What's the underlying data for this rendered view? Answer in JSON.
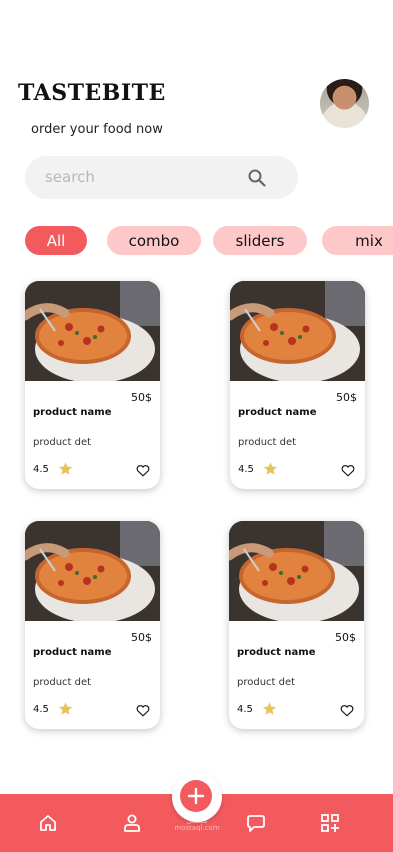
{
  "header": {
    "brand": "TASTEBITE",
    "tagline": "order your food  now",
    "avatar_icon": "user-avatar"
  },
  "search": {
    "placeholder": "search",
    "icon": "search-icon"
  },
  "categories": [
    {
      "label": "All",
      "active": true
    },
    {
      "label": "combo",
      "active": false
    },
    {
      "label": "sliders",
      "active": false
    },
    {
      "label": "mix",
      "active": false
    }
  ],
  "products": [
    {
      "name": "product name",
      "details": "product det",
      "price": "50$",
      "rating": "4.5"
    },
    {
      "name": "product name",
      "details": "product det",
      "price": "50$",
      "rating": "4.5"
    },
    {
      "name": "product name",
      "details": "product det",
      "price": "50$",
      "rating": "4.5"
    },
    {
      "name": "product name",
      "details": "product det",
      "price": "50$",
      "rating": "4.5"
    }
  ],
  "bottom_nav": {
    "items": [
      "home-icon",
      "profile-icon",
      "chat-icon",
      "qr-grid-icon"
    ],
    "fab_icon": "plus-icon",
    "watermark": [
      "مستقل",
      "mostaql.com"
    ]
  },
  "colors": {
    "accent": "#f25a5e",
    "chip": "#ffc8c8",
    "search_bg": "#f2f2f2",
    "star": "#e8c35a"
  }
}
